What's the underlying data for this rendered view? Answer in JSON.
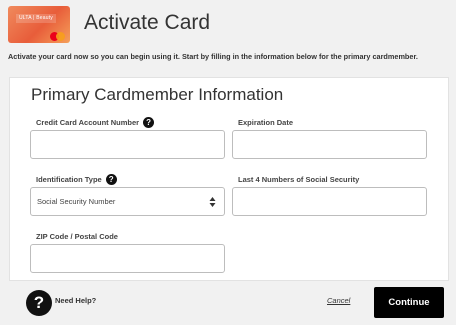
{
  "header": {
    "title": "Activate Card",
    "card_logo_text": "ULTA | Beauty",
    "intro": "Activate your card now so you can begin using it. Start by filling in the information below for the primary cardmember."
  },
  "form": {
    "section_title": "Primary Cardmember Information",
    "account_number": {
      "label": "Credit Card Account Number",
      "value": "",
      "help_icon": "?"
    },
    "expiration_date": {
      "label": "Expiration Date",
      "value": ""
    },
    "identification_type": {
      "label": "Identification Type",
      "selected": "Social Security Number",
      "help_icon": "?"
    },
    "ssn_last4": {
      "label": "Last 4 Numbers of Social Security",
      "value": ""
    },
    "zip": {
      "label": "ZIP Code / Postal Code",
      "value": ""
    }
  },
  "footer": {
    "help_icon": "?",
    "help_text": "Need Help?",
    "cancel_label": "Cancel",
    "continue_label": "Continue"
  }
}
